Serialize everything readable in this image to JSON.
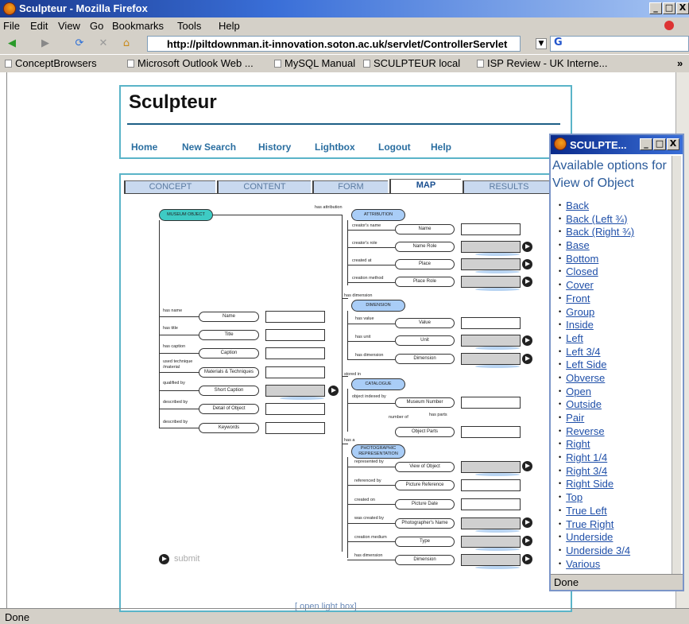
{
  "browser": {
    "title": "Sculpteur - Mozilla Firefox",
    "menu": [
      "File",
      "Edit",
      "View",
      "Go",
      "Bookmarks",
      "Tools",
      "Help"
    ],
    "url": "http://piltdownman.it-innovation.soton.ac.uk/servlet/ControllerServlet",
    "bookmarks": [
      "ConceptBrowsers",
      "Microsoft Outlook Web ...",
      "MySQL Manual",
      "SCULPTEUR local",
      "ISP Review - UK Interne..."
    ],
    "status": "Done",
    "min_btn": "_",
    "max_btn": "□",
    "close_btn": "X",
    "more": "»"
  },
  "page": {
    "logo": "Sculpteur",
    "nav": [
      "Home",
      "New Search",
      "History",
      "Lightbox",
      "Logout",
      "Help"
    ],
    "tabs": [
      "CONCEPT",
      "CONTENT",
      "FORM",
      "MAP",
      "RESULTS"
    ],
    "active_tab": "MAP",
    "submit": "submit",
    "open_lightbox": "[ open light box]"
  },
  "map": {
    "museum_object": "MUSEUM OBJECT",
    "has_attribution": "has attribution",
    "attribution": "ATTRIBUTION",
    "creators_name": "creator's name",
    "name_node": "Name",
    "creators_role": "creator's role",
    "name_role": "Name Role",
    "created_at": "created at",
    "place": "Place",
    "creation_method": "creation method",
    "place_role": "Place Role",
    "has_dimension": "has dimension",
    "dimension": "DIMENSION",
    "has_value": "has value",
    "value": "Value",
    "has_unit": "has unit",
    "unit": "Unit",
    "has_dimension2": "has dimension",
    "dimension_node": "Dimension",
    "has_name": "has name",
    "has_title": "has title",
    "title": "Title",
    "has_caption": "has caption",
    "caption": "Caption",
    "used_technique": "used technique",
    "material": "/material",
    "mat_tech": "Materials & Techniques",
    "qualified_by": "qualified by",
    "short_caption": "Short Caption",
    "described_by": "described by",
    "detail": "Detail of Object",
    "described_by2": "described by",
    "keywords": "Keywords",
    "stored_in": "stored in",
    "catalogue": "CATALOGUE",
    "object_indexed_by": "object indexed by",
    "museum_number": "Museum Number",
    "number_of": "number of",
    "has_parts": "has parts",
    "object_parts": "Object Parts",
    "has_a": "has a",
    "photo1": "PHOTOGRAPHIC",
    "photo2": "REPRESENTATION",
    "represented_by": "represented by",
    "view_of_object": "View of Object",
    "referenced_by": "referenced by",
    "picture_reference": "Picture Reference",
    "created_on": "created on",
    "picture_date": "Picture Date",
    "was_created_by": "was created by",
    "photographers_name": "Photographer's Name",
    "creation_medium": "creation medium",
    "type": "Type",
    "has_dimension3": "has dimension",
    "dimension_node2": "Dimension"
  },
  "popup": {
    "title": "SCULPTE...",
    "heading": "Available options for View of Object",
    "options": [
      "Back",
      "Back (Left ¾)",
      "Back (Right ¾)",
      "Base",
      "Bottom",
      "Closed",
      "Cover",
      "Front",
      "Group",
      "Inside",
      "Left",
      "Left 3/4",
      "Left Side",
      "Obverse",
      "Open",
      "Outside",
      "Pair",
      "Reverse",
      "Right",
      "Right 1/4",
      "Right 3/4",
      "Right Side",
      "Top",
      "True Left",
      "True Right",
      "Underside",
      "Underside 3/4",
      "Various"
    ],
    "status": "Done"
  }
}
